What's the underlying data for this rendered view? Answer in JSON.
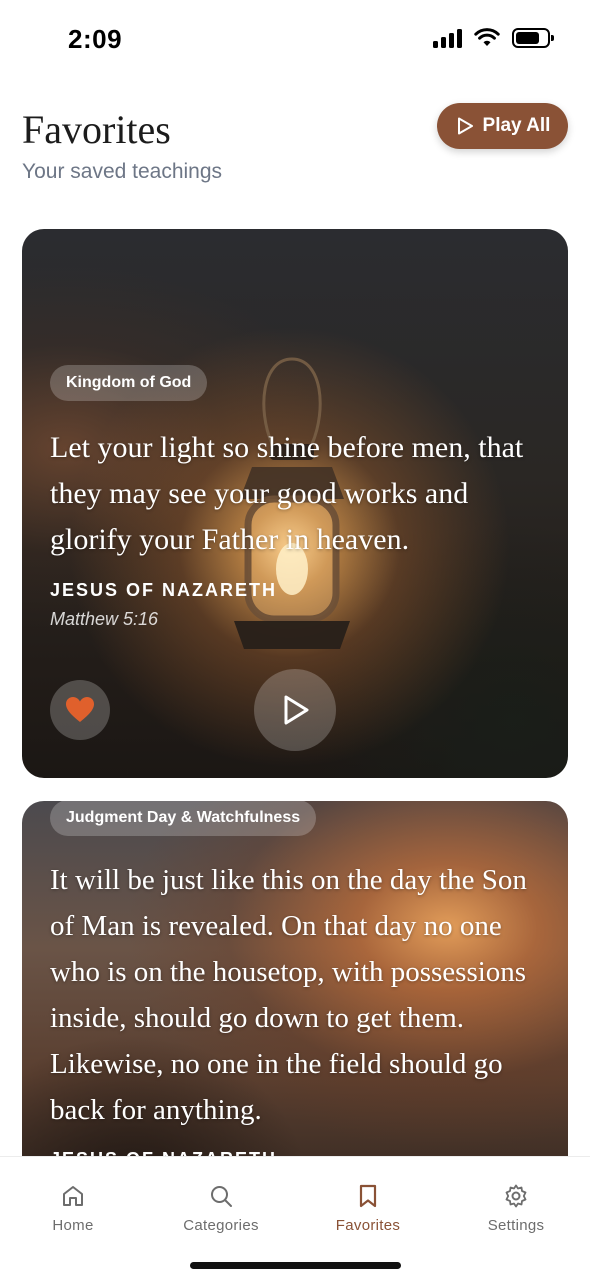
{
  "status_bar": {
    "time": "2:09",
    "battery_level": 0.78
  },
  "header": {
    "title": "Favorites",
    "subtitle": "Your saved teachings",
    "play_all_label": "Play All"
  },
  "cards": [
    {
      "category": "Kingdom of God",
      "quote": "Let your light so shine before men, that they may see your good works and glorify your Father in heaven.",
      "speaker": "JESUS OF NAZARETH",
      "reference": "Matthew 5:16",
      "favorited": true
    },
    {
      "category": "Judgment Day & Watchfulness",
      "quote": "It will be just like this on the day the Son of Man is revealed. On that day no one who is on the housetop, with possessions inside, should go down to get them. Likewise, no one in the field should go back for anything.",
      "speaker": "JESUS OF NAZARETH"
    }
  ],
  "tab_bar": {
    "items": [
      {
        "label": "Home",
        "icon": "home-icon"
      },
      {
        "label": "Categories",
        "icon": "search-icon"
      },
      {
        "label": "Favorites",
        "icon": "bookmark-icon",
        "active": true
      },
      {
        "label": "Settings",
        "icon": "gear-icon"
      }
    ]
  },
  "colors": {
    "accent": "#8a5236",
    "heart": "#e0602c",
    "subtitle": "#6d7686"
  }
}
